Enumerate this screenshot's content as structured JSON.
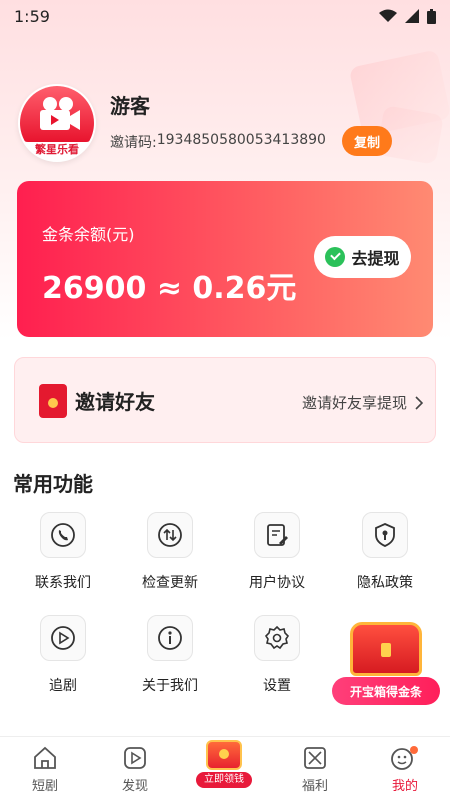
{
  "status_bar": {
    "time": "1:59"
  },
  "profile": {
    "avatar_text": "繁星乐看",
    "username": "游客",
    "invite_label": "邀请码: ",
    "invite_code": "1934850580053413890",
    "copy_label": "复制"
  },
  "balance": {
    "label": "金条余额(元)",
    "value": "26900 ≈ 0.26元",
    "withdraw_label": "去提现"
  },
  "invite": {
    "title": "邀请好友",
    "link_text": "邀请好友享提现"
  },
  "functions": {
    "title": "常用功能",
    "items": [
      {
        "label": "联系我们",
        "icon": "phone-icon"
      },
      {
        "label": "检查更新",
        "icon": "update-icon"
      },
      {
        "label": "用户协议",
        "icon": "document-icon"
      },
      {
        "label": "隐私政策",
        "icon": "shield-icon"
      },
      {
        "label": "追剧",
        "icon": "play-icon"
      },
      {
        "label": "关于我们",
        "icon": "info-icon"
      },
      {
        "label": "设置",
        "icon": "gear-icon"
      }
    ]
  },
  "treasure": {
    "label": "开宝箱得金条"
  },
  "nav": {
    "items": [
      {
        "label": "短剧",
        "icon": "home-icon"
      },
      {
        "label": "发现",
        "icon": "play-icon"
      },
      {
        "label": "立即领钱",
        "icon": "gift-icon"
      },
      {
        "label": "福利",
        "icon": "grid-icon"
      },
      {
        "label": "我的",
        "icon": "profile-icon"
      }
    ],
    "active": "我的"
  },
  "colors": {
    "accent": "#e8193a",
    "orange": "#ff7a1a",
    "card_start": "#ff1f4f",
    "card_end": "#ff8a72"
  }
}
